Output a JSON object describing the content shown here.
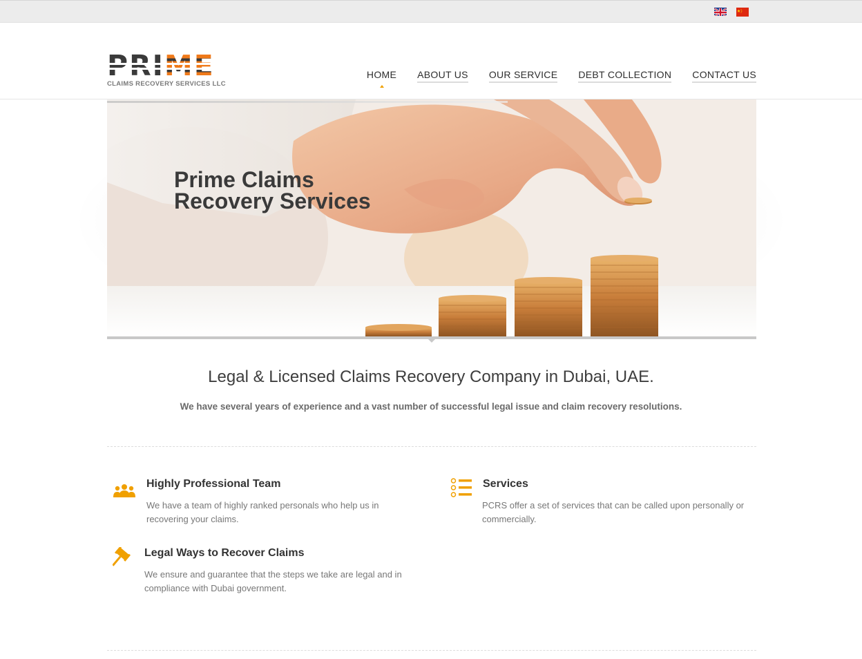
{
  "languages": [
    {
      "name": "English",
      "icon": "uk-flag-icon"
    },
    {
      "name": "Chinese",
      "icon": "china-flag-icon"
    }
  ],
  "logo": {
    "word": "PRIME",
    "tagline": "CLAIMS RECOVERY SERVICES LLC",
    "accent_color": "#f07a1a"
  },
  "nav": [
    {
      "label": "HOME",
      "active": true
    },
    {
      "label": "ABOUT US",
      "active": false
    },
    {
      "label": "OUR SERVICE",
      "active": false
    },
    {
      "label": "DEBT COLLECTION",
      "active": false
    },
    {
      "label": "CONTACT US",
      "active": false
    }
  ],
  "hero": {
    "title_line1": "Prime Claims",
    "title_line2": "Recovery Services"
  },
  "intro": {
    "title": "Legal & Licensed Claims Recovery Company in Dubai, UAE.",
    "subtitle": "We have several years of experience and a vast number of successful legal issue and claim recovery resolutions."
  },
  "features": [
    {
      "icon": "team-icon",
      "title": "Highly Professional Team",
      "text": "We have a team of highly ranked personals who help us in recovering your claims."
    },
    {
      "icon": "list-icon",
      "title": "Services",
      "text": "PCRS offer a set of services that can be called upon personally or commercially."
    },
    {
      "icon": "gavel-icon",
      "title": "Legal Ways to Recover Claims",
      "text": "We ensure and guarantee that the steps we take are legal and in compliance with Dubai government."
    }
  ],
  "colors": {
    "accent": "#f0a000",
    "text_dark": "#333333",
    "text_muted": "#777777"
  }
}
